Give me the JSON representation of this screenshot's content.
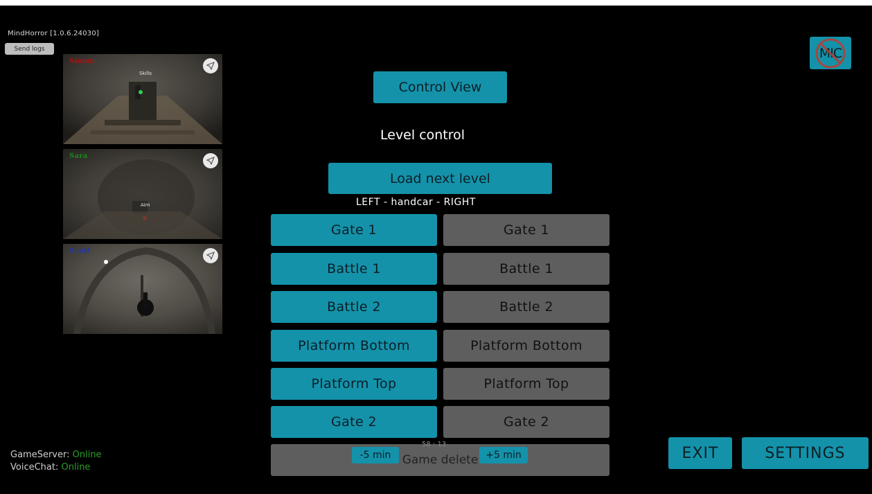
{
  "app": {
    "title": "MindHorror [1.0.6.24030]",
    "send_logs_label": "Send logs"
  },
  "cameras": [
    {
      "player": "Simon",
      "name_color": "#b01010",
      "tag": "Skills",
      "icon": "location-arrow-icon"
    },
    {
      "player": "Sara",
      "name_color": "#1a8a1a",
      "tag": "Aim",
      "icon": "location-arrow-icon"
    },
    {
      "player": "Scott",
      "name_color": "#2236a8",
      "tag": "",
      "icon": "location-arrow-icon"
    }
  ],
  "mic_button": {
    "label": "MIC",
    "state": "muted"
  },
  "control": {
    "control_view_label": "Control View",
    "level_control_heading": "Level control",
    "load_next_level_label": "Load next level",
    "handcar_label": "LEFT - handcar - RIGHT",
    "left_column": [
      "Gate 1",
      "Battle 1",
      "Battle 2",
      "Platform Bottom",
      "Platform Top",
      "Gate 2"
    ],
    "right_column": [
      "Gate 1",
      "Battle 1",
      "Battle 2",
      "Platform Bottom",
      "Platform Top",
      "Gate 2"
    ],
    "game_delete_label": "Game delete",
    "timer": "58 : 13",
    "minus_label": "-5 min",
    "plus_label": "+5 min"
  },
  "status": {
    "game_server_label": "GameServer:",
    "game_server_value": "Online",
    "voice_chat_label": "VoiceChat:",
    "voice_chat_value": "Online"
  },
  "actions": {
    "exit_label": "EXIT",
    "settings_label": "SETTINGS"
  },
  "colors": {
    "accent": "#1492aa",
    "inactive": "#5e5e5e",
    "online": "#2aa02a",
    "background": "#000000"
  }
}
